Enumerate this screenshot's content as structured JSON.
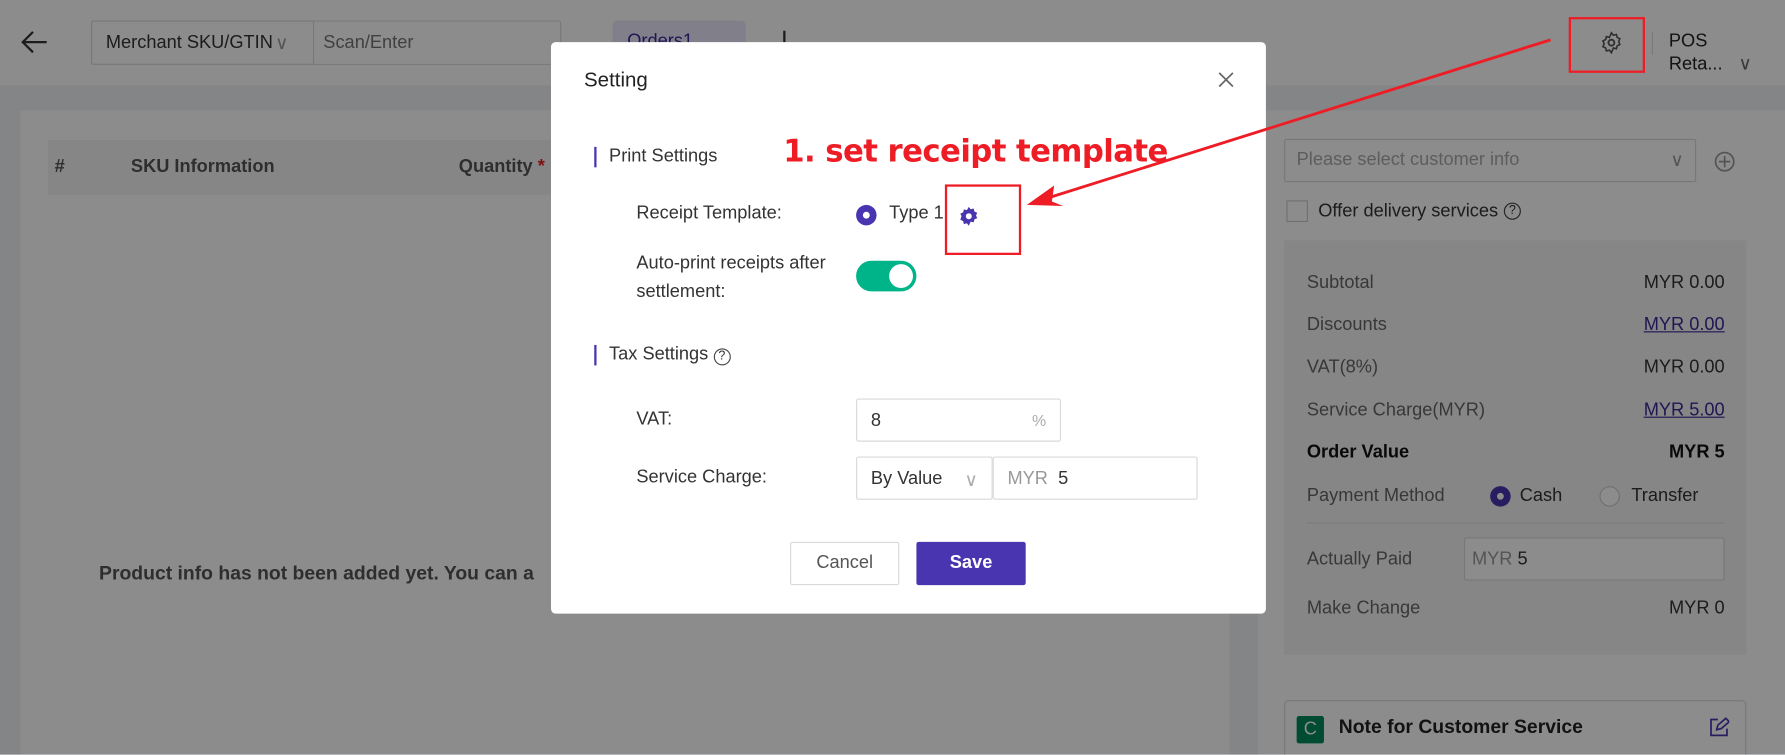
{
  "header": {
    "back_icon": "arrow-left-icon",
    "search_type": "Merchant SKU/GTIN",
    "search_placeholder": "Scan/Enter",
    "order_tab": "Orders1",
    "settings_icon": "gear-icon",
    "store_name": "POS Reta..."
  },
  "table": {
    "columns": [
      "#",
      "SKU Information",
      "Quantity"
    ],
    "required_mark": "*",
    "empty_text": "Product info has not been added yet. You can a"
  },
  "customer": {
    "placeholder": "Please select customer info",
    "delivery_label": "Offer delivery services"
  },
  "summary": {
    "rows": [
      {
        "label": "Subtotal",
        "value": "MYR 0.00"
      },
      {
        "label": "Discounts",
        "value": "MYR 0.00"
      },
      {
        "label": "VAT(8%)",
        "value": "MYR 0.00"
      },
      {
        "label": "Service Charge(MYR)",
        "value": "MYR 5.00"
      },
      {
        "label": "Order Value",
        "value": "MYR 5"
      }
    ],
    "payment_label": "Payment Method",
    "payment_options": [
      "Cash",
      "Transfer"
    ],
    "payment_selected": "Cash",
    "paid_label": "Actually Paid",
    "paid_prefix": "MYR",
    "paid_value": "5",
    "change_label": "Make Change",
    "change_value": "MYR 0"
  },
  "note": {
    "badge": "C",
    "title": "Note for Customer Service"
  },
  "modal": {
    "title": "Setting",
    "print_section": "Print Settings",
    "receipt_label": "Receipt Template:",
    "receipt_value": "Type 1",
    "autoprint_label_1": "Auto-print receipts after",
    "autoprint_label_2": "settlement:",
    "autoprint_on": true,
    "tax_section": "Tax Settings",
    "vat_label": "VAT:",
    "vat_value": "8",
    "vat_suffix": "%",
    "service_label": "Service Charge:",
    "service_mode": "By Value",
    "service_prefix": "MYR",
    "service_value": "5",
    "cancel": "Cancel",
    "save": "Save"
  },
  "annotation": {
    "text": "1. set receipt template",
    "color": "#ee1c25"
  },
  "colors": {
    "accent": "#4a35b0",
    "toggle": "#00b48a",
    "annotation": "#ee1c25"
  }
}
